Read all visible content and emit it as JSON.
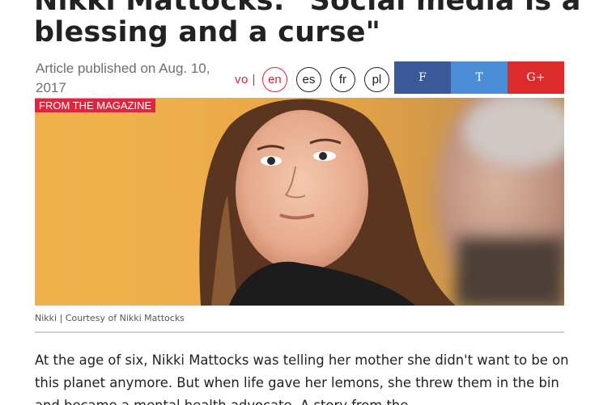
{
  "article": {
    "title_line1": "Nikki Mattocks: \"Social media is a",
    "title_line2": "blessing and a curse\"",
    "published": "Article published on Aug. 10, 2017"
  },
  "languages": {
    "vo_label": "vo |",
    "items": [
      "en",
      "es",
      "fr",
      "pl"
    ],
    "active": "en"
  },
  "share": {
    "facebook": "F",
    "twitter": "T",
    "google": "G+"
  },
  "colors": {
    "accent": "#d8253a",
    "facebook": "#3b5998",
    "twitter": "#4a8dd6",
    "google": "#dd2b2b"
  },
  "image": {
    "tag": "FROM THE MAGAZINE",
    "caption": "Nikki | Courtesy of Nikki Mattocks"
  },
  "lead": "At the age of six, Nikki Mattocks was telling her mother she didn't want to be on this planet anymore. But when life gave her lemons, she threw them in the bin and became a mental health advocate. A story from the"
}
